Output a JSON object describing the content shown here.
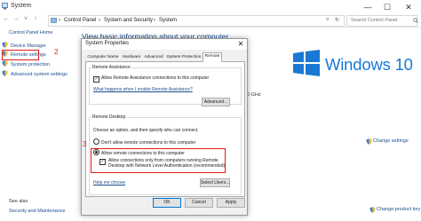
{
  "window": {
    "title": "System",
    "minimize_glyph": "—",
    "maximize_glyph": "☐",
    "close_glyph": "✕"
  },
  "address": {
    "crumbs": [
      "Control Panel",
      "System and Security",
      "System"
    ],
    "separator": "›",
    "refresh_glyph": "↻"
  },
  "search": {
    "placeholder": "Search Control Panel"
  },
  "leftnav": {
    "home": "Control Panel Home",
    "items": [
      {
        "label": "Device Manager"
      },
      {
        "label": "Remote settings"
      },
      {
        "label": "System protection"
      },
      {
        "label": "Advanced system settings"
      }
    ],
    "see_also": "See also",
    "security": "Security and Maintenance"
  },
  "main": {
    "heading": "View basic information about your computer",
    "windows_logo_text": "Windows 10",
    "cpu_freq": "0 GHz",
    "change_settings": "Change settings",
    "change_key": "Change product key"
  },
  "annotations": {
    "step2": "2",
    "step3": "3"
  },
  "dialog": {
    "title": "System Properties",
    "close_glyph": "✕",
    "tabs": [
      "Computer Name",
      "Hardware",
      "Advanced",
      "System Protection",
      "Remote"
    ],
    "active_tab": "Remote",
    "remote_assistance": {
      "group_label": "Remote Assistance",
      "allow_label": "Allow Remote Assistance connections to this computer",
      "allow_checked": true,
      "help_link": "What happens when I enable Remote Assistance?",
      "advanced_button": "Advanced..."
    },
    "remote_desktop": {
      "group_label": "Remote Desktop",
      "choose_text": "Choose an option, and then specify who can connect.",
      "dont_allow": "Don't allow remote connections to this computer",
      "allow": "Allow remote connections to this computer",
      "selected": "allow",
      "nla_label": "Allow connections only from computers running Remote Desktop with Network Level Authentication (recommended)",
      "nla_checked": true,
      "help_link": "Help me choose",
      "select_users_button": "Select Users..."
    },
    "buttons": {
      "ok": "OK",
      "cancel": "Cancel",
      "apply": "Apply"
    }
  },
  "colors": {
    "accent": "#1a4d8f",
    "annotation_red": "#e01c1c",
    "windows_blue": "#1a78d4"
  }
}
